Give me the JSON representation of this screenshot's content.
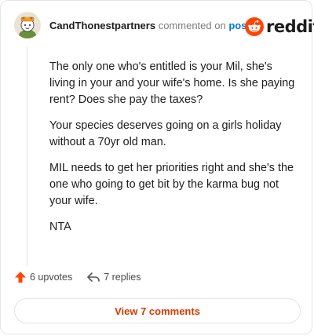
{
  "comment": {
    "username": "CandThonestpartners",
    "action_text": "commented on",
    "post_link_text": "post",
    "paragraphs": [
      "The only one who's entitled is your Mil, she's living in your and your wife's home. Is she paying rent? Does she pay the taxes?",
      "Your species deserves going on a girls holiday without a 70yr old man.",
      "MIL needs to get her priorities right and she's the one who going to get bit by the karma bug not your wife.",
      "NTA"
    ]
  },
  "brand": {
    "wordmark": "reddit",
    "icon": "reddit-snoo-icon",
    "color": "#ff4500"
  },
  "actions": {
    "upvotes_label": "6 upvotes",
    "replies_label": "7 replies"
  },
  "view_comments_label": "View 7 comments",
  "colors": {
    "accent": "#ff4500",
    "link": "#0079d3",
    "button_text": "#d93a00"
  }
}
